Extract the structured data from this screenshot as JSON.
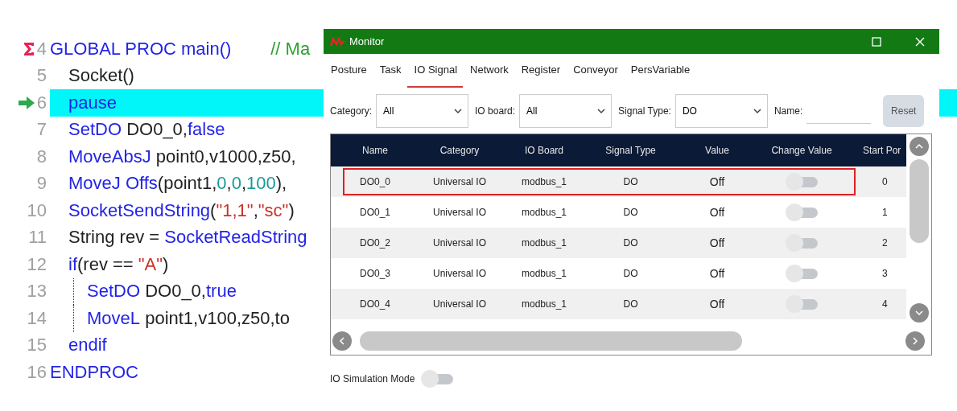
{
  "code": {
    "lines": [
      {
        "number": "4",
        "entry": true,
        "current": false,
        "tokens": [
          {
            "kind": "keyword",
            "text": "GLOBAL PROC main()"
          },
          {
            "kind": "comment",
            "text": "        // Ma"
          }
        ],
        "children": [
          {
            "number": "5",
            "current": false,
            "tokens": [
              {
                "kind": "plain",
                "text": "Socket()"
              }
            ]
          },
          {
            "number": "6",
            "current": true,
            "tokens": [
              {
                "kind": "keyword",
                "text": "pause"
              }
            ]
          },
          {
            "number": "7",
            "current": false,
            "tokens": [
              {
                "kind": "keyword",
                "text": "SetDO"
              },
              {
                "kind": "plain",
                "text": " DO0_0,"
              },
              {
                "kind": "keyword",
                "text": "false"
              }
            ]
          },
          {
            "number": "8",
            "current": false,
            "tokens": [
              {
                "kind": "keyword",
                "text": "MoveAbsJ"
              },
              {
                "kind": "plain",
                "text": " point0,v1000,z50,"
              }
            ]
          },
          {
            "number": "9",
            "current": false,
            "tokens": [
              {
                "kind": "keyword",
                "text": "MoveJ Offs"
              },
              {
                "kind": "plain",
                "text": "(point1,"
              },
              {
                "kind": "number",
                "text": "0"
              },
              {
                "kind": "plain",
                "text": ","
              },
              {
                "kind": "number",
                "text": "0"
              },
              {
                "kind": "plain",
                "text": ","
              },
              {
                "kind": "number",
                "text": "100"
              },
              {
                "kind": "plain",
                "text": "),"
              }
            ]
          },
          {
            "number": "10",
            "current": false,
            "tokens": [
              {
                "kind": "keyword",
                "text": "SocketSendString"
              },
              {
                "kind": "plain",
                "text": "("
              },
              {
                "kind": "string",
                "text": "\"1,1\""
              },
              {
                "kind": "plain",
                "text": ","
              },
              {
                "kind": "string",
                "text": "\"sc\""
              },
              {
                "kind": "plain",
                "text": ")"
              }
            ]
          },
          {
            "number": "11",
            "current": false,
            "tokens": [
              {
                "kind": "plain",
                "text": "String rev = "
              },
              {
                "kind": "keyword",
                "text": "SocketReadString"
              }
            ]
          },
          {
            "number": "12",
            "current": false,
            "tokens": [
              {
                "kind": "keyword",
                "text": "if"
              },
              {
                "kind": "plain",
                "text": "(rev == "
              },
              {
                "kind": "string",
                "text": "\"A\""
              },
              {
                "kind": "plain",
                "text": ")"
              }
            ],
            "children": [
              {
                "number": "13",
                "current": false,
                "tokens": [
                  {
                    "kind": "keyword",
                    "text": "SetDO"
                  },
                  {
                    "kind": "plain",
                    "text": " DO0_0,"
                  },
                  {
                    "kind": "keyword",
                    "text": "true"
                  }
                ]
              },
              {
                "number": "14",
                "current": false,
                "tokens": [
                  {
                    "kind": "keyword",
                    "text": "MoveL"
                  },
                  {
                    "kind": "plain",
                    "text": " point1,v100,z50,to"
                  }
                ]
              }
            ]
          },
          {
            "number": "15",
            "current": false,
            "tokens": [
              {
                "kind": "keyword",
                "text": "endif"
              }
            ]
          }
        ]
      },
      {
        "number": "16",
        "current": false,
        "tokens": [
          {
            "kind": "keyword",
            "text": "ENDPROC"
          }
        ]
      }
    ]
  },
  "window": {
    "title": "Monitor",
    "tabs": [
      {
        "label": "Posture",
        "selected": false
      },
      {
        "label": "Task",
        "selected": false
      },
      {
        "label": "IO Signal",
        "selected": true
      },
      {
        "label": "Network",
        "selected": false
      },
      {
        "label": "Register",
        "selected": false
      },
      {
        "label": "Conveyor",
        "selected": false
      },
      {
        "label": "PersVariable",
        "selected": false
      }
    ],
    "filters": [
      {
        "label": "Category:",
        "value": "All"
      },
      {
        "label": "IO board:",
        "value": "All"
      },
      {
        "label": "Signal Type:",
        "value": "DO"
      }
    ],
    "name_filter": {
      "label": "Name:"
    },
    "reset_button": "Reset",
    "table": {
      "columns": [
        "Name",
        "Category",
        "IO Board",
        "Signal Type",
        "Value",
        "Change Value",
        "Start Por"
      ],
      "rows": [
        {
          "name": "DO0_0",
          "category": "Universal IO",
          "io_board": "modbus_1",
          "signal_type": "DO",
          "value": "Off",
          "on": false,
          "start_port": "0",
          "highlighted": true
        },
        {
          "name": "DO0_1",
          "category": "Universal IO",
          "io_board": "modbus_1",
          "signal_type": "DO",
          "value": "Off",
          "on": false,
          "start_port": "1",
          "highlighted": false
        },
        {
          "name": "DO0_2",
          "category": "Universal IO",
          "io_board": "modbus_1",
          "signal_type": "DO",
          "value": "Off",
          "on": false,
          "start_port": "2",
          "highlighted": false
        },
        {
          "name": "DO0_3",
          "category": "Universal IO",
          "io_board": "modbus_1",
          "signal_type": "DO",
          "value": "Off",
          "on": false,
          "start_port": "3",
          "highlighted": false
        },
        {
          "name": "DO0_4",
          "category": "Universal IO",
          "io_board": "modbus_1",
          "signal_type": "DO",
          "value": "Off",
          "on": false,
          "start_port": "4",
          "highlighted": false
        }
      ]
    },
    "simulation": {
      "label": "IO Simulation Mode",
      "on": false
    }
  }
}
